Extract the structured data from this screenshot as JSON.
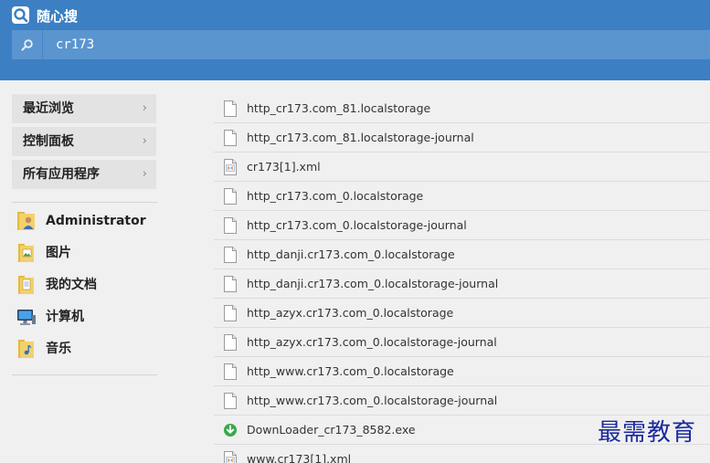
{
  "app": {
    "title": "随心搜",
    "logo_icon": "search-logo-icon"
  },
  "search": {
    "value": "cr173",
    "icon": "search-icon"
  },
  "left_nav": {
    "items": [
      {
        "label": "最近浏览",
        "arrow": "›"
      },
      {
        "label": "控制面板",
        "arrow": "›"
      },
      {
        "label": "所有应用程序",
        "arrow": "›"
      }
    ]
  },
  "places": [
    {
      "label": "Administrator",
      "icon": "user-folder-icon"
    },
    {
      "label": "图片",
      "icon": "pictures-folder-icon"
    },
    {
      "label": "我的文档",
      "icon": "documents-folder-icon"
    },
    {
      "label": "计算机",
      "icon": "computer-icon"
    },
    {
      "label": "音乐",
      "icon": "music-folder-icon"
    }
  ],
  "files": [
    {
      "name": "http_cr173.com_81.localstorage",
      "icon": "file-icon"
    },
    {
      "name": "http_cr173.com_81.localstorage-journal",
      "icon": "file-icon"
    },
    {
      "name": "cr173[1].xml",
      "icon": "xml-file-icon"
    },
    {
      "name": "http_cr173.com_0.localstorage",
      "icon": "file-icon"
    },
    {
      "name": "http_cr173.com_0.localstorage-journal",
      "icon": "file-icon"
    },
    {
      "name": "http_danji.cr173.com_0.localstorage",
      "icon": "file-icon"
    },
    {
      "name": "http_danji.cr173.com_0.localstorage-journal",
      "icon": "file-icon"
    },
    {
      "name": "http_azyx.cr173.com_0.localstorage",
      "icon": "file-icon"
    },
    {
      "name": "http_azyx.cr173.com_0.localstorage-journal",
      "icon": "file-icon"
    },
    {
      "name": "http_www.cr173.com_0.localstorage",
      "icon": "file-icon"
    },
    {
      "name": "http_www.cr173.com_0.localstorage-journal",
      "icon": "file-icon"
    },
    {
      "name": "DownLoader_cr173_8582.exe",
      "icon": "download-exe-icon"
    },
    {
      "name": "www.cr173[1].xml",
      "icon": "xml-file-icon"
    }
  ],
  "watermark": {
    "text": "最需教育"
  },
  "colors": {
    "header": "#3c7fc3",
    "search_bar": "#5b95cf",
    "background": "#f0f0f0",
    "nav_item": "#e3e3e3",
    "download_green": "#3aa84a"
  }
}
